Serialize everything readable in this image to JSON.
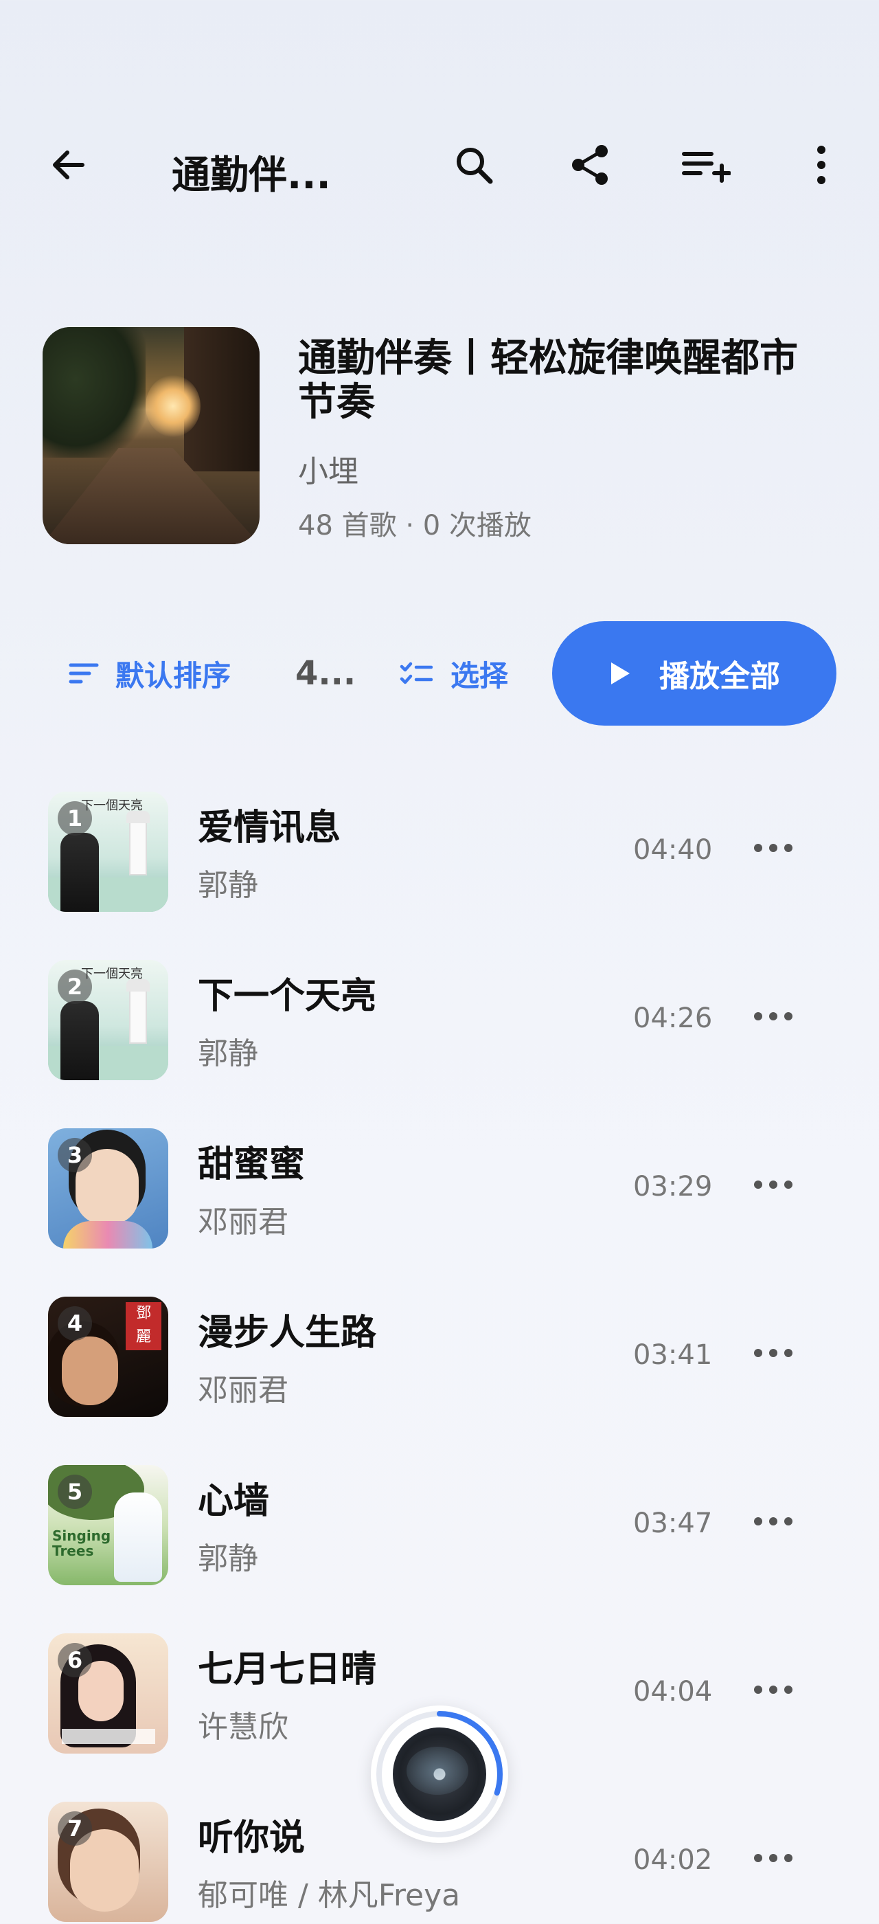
{
  "header": {
    "title": "通勤伴...",
    "icons": [
      "back-arrow-icon",
      "search-icon",
      "share-icon",
      "add-to-playlist-icon",
      "more-vertical-icon"
    ]
  },
  "playlist": {
    "title": "通勤伴奏丨轻松旋律唤醒都市节奏",
    "author": "小埋",
    "stats": "48 首歌 · 0 次播放"
  },
  "actions": {
    "sort_label": "默认排序",
    "count_label": "4...",
    "select_label": "选择",
    "play_all_label": "播放全部"
  },
  "colors": {
    "accent": "#3a78f0",
    "background": "#eef1f8"
  },
  "songs": [
    {
      "num": "1",
      "title": "爱情讯息",
      "artist": "郭静",
      "duration": "04:40",
      "art": "lighthouse"
    },
    {
      "num": "2",
      "title": "下一个天亮",
      "artist": "郭静",
      "duration": "04:26",
      "art": "lighthouse"
    },
    {
      "num": "3",
      "title": "甜蜜蜜",
      "artist": "邓丽君",
      "duration": "03:29",
      "art": "blue"
    },
    {
      "num": "4",
      "title": "漫步人生路",
      "artist": "邓丽君",
      "duration": "03:41",
      "art": "dark"
    },
    {
      "num": "5",
      "title": "心墙",
      "artist": "郭静",
      "duration": "03:47",
      "art": "garden"
    },
    {
      "num": "6",
      "title": "七月七日晴",
      "artist": "许慧欣",
      "duration": "04:04",
      "art": "pink"
    },
    {
      "num": "7",
      "title": "听你说",
      "artist": "郁可唯 / 林凡Freya",
      "duration": "04:02",
      "art": "warm"
    }
  ],
  "mini_player": {
    "progress": 0.3
  }
}
